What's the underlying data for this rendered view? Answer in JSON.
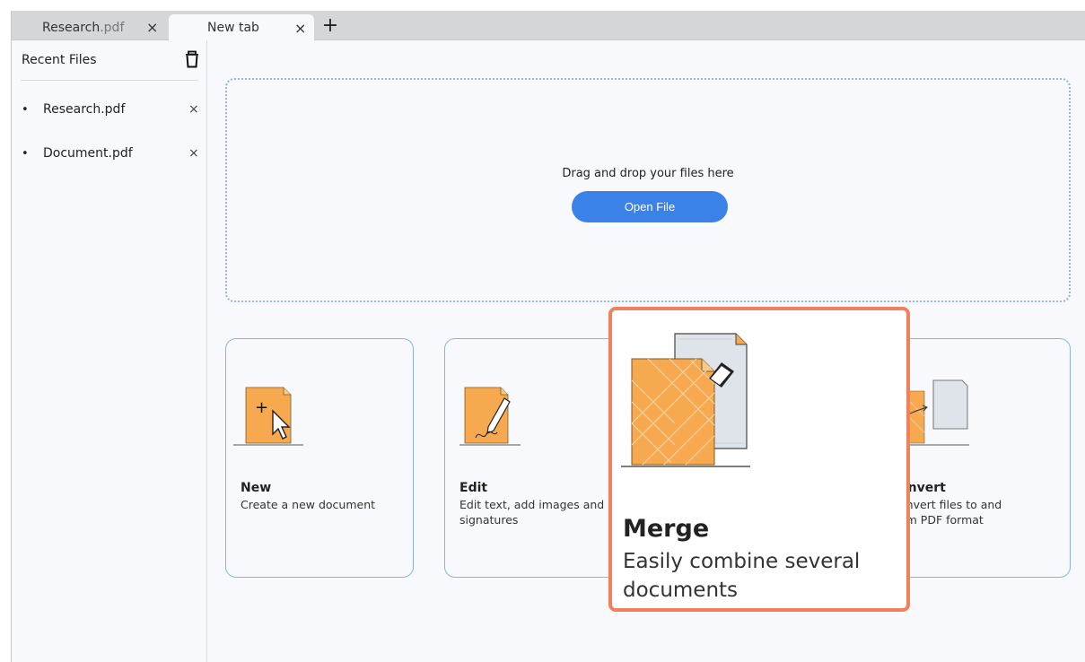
{
  "tabs": [
    {
      "label_name": "Research",
      "label_ext": ".pdf",
      "close": "×"
    },
    {
      "label": "New tab",
      "close": "×"
    }
  ],
  "new_tab_symbol": "+",
  "sidebar": {
    "header": "Recent Files",
    "trash_icon": "trash-icon",
    "items": [
      {
        "bullet": "•",
        "name": "Research.pdf",
        "remove": "×"
      },
      {
        "bullet": "•",
        "name": "Document.pdf",
        "remove": "×"
      }
    ]
  },
  "dropzone": {
    "text": "Drag and drop your files here",
    "button": "Open File"
  },
  "cards": {
    "new": {
      "title": "New",
      "desc": "Create a new document",
      "icon": "new-document-icon"
    },
    "edit": {
      "title": "Edit",
      "desc": "Edit text, add images and signatures",
      "icon": "edit-document-icon"
    },
    "convert": {
      "title": "onvert",
      "desc_line1": "onvert files to and",
      "desc_line2": "om PDF format",
      "icon": "convert-document-icon"
    },
    "merge": {
      "title": "Merge",
      "desc": "Easily combine several documents",
      "icon": "merge-documents-icon"
    }
  },
  "colors": {
    "accent": "#3b82e8",
    "card_border": "#8fb1e6",
    "highlight": "#f0805e",
    "document_orange": "#f7a94f"
  }
}
